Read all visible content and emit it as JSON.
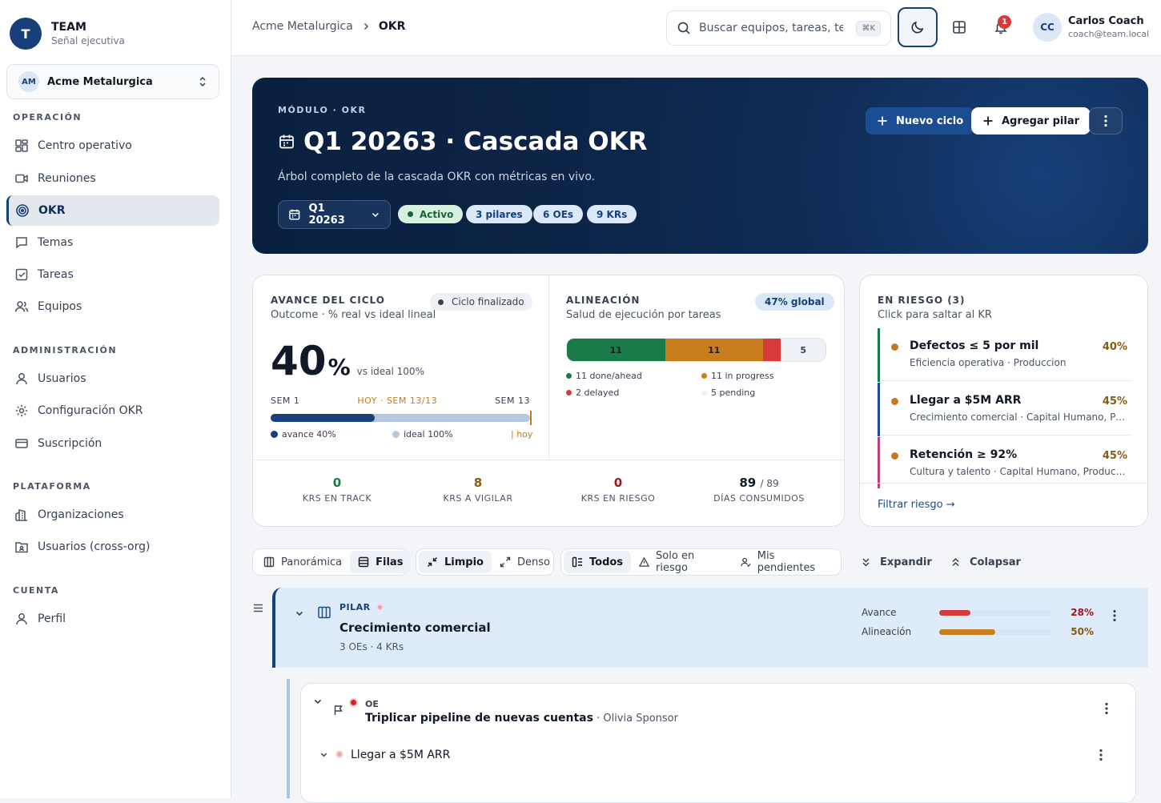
{
  "brand": {
    "initial": "T",
    "title": "TEAM",
    "subtitle": "Señal ejecutiva"
  },
  "org": {
    "initials": "AM",
    "name": "Acme Metalurgica"
  },
  "nav": {
    "operacion": "OPERACIÓN",
    "administracion": "ADMINISTRACIÓN",
    "plataforma": "PLATAFORMA",
    "cuenta": "CUENTA",
    "centro": "Centro operativo",
    "reuniones": "Reuniones",
    "okr": "OKR",
    "temas": "Temas",
    "tareas": "Tareas",
    "equipos": "Equipos",
    "usuarios": "Usuarios",
    "config_okr": "Configuración OKR",
    "suscripcion": "Suscripción",
    "organizaciones": "Organizaciones",
    "usuarios_cross": "Usuarios (cross-org)",
    "perfil": "Perfil"
  },
  "topbar": {
    "crumb_root": "Acme Metalurgica",
    "crumb_current": "OKR",
    "search_placeholder": "Buscar equipos, tareas, tem",
    "search_kbd": "⌘K",
    "notifications": "1",
    "user_initials": "CC",
    "user_name": "Carlos Coach",
    "user_email": "coach@team.local"
  },
  "hero": {
    "kicker": "MÓDULO · OKR",
    "title": "Q1 20263 · Cascada OKR",
    "description": "Árbol completo de la cascada OKR con métricas en vivo.",
    "cycle": "Q1 20263",
    "status": "Activo",
    "chip_pilares": "3 pilares",
    "chip_oes": "6 OEs",
    "chip_krs": "9 KRs",
    "btn_new": "Nuevo ciclo",
    "btn_add": "Agregar pilar"
  },
  "avance": {
    "title": "AVANCE DEL CICLO",
    "subtitle": "Outcome · % real vs ideal lineal",
    "badge": "Ciclo finalizado",
    "value": "40",
    "unit": "%",
    "ideal": "vs ideal 100%",
    "week_start": "SEM 1",
    "week_now": "HOY · SEM 13/13",
    "week_end": "SEM 13",
    "progress_fraction": 0.4,
    "legend_avance": "avance 40%",
    "legend_ideal": "ideal 100%",
    "legend_hoy": "| hoy"
  },
  "alineacion": {
    "title": "ALINEACIÓN",
    "subtitle": "Salud de ejecución por tareas",
    "badge": "47% global",
    "segments": [
      {
        "label": "11",
        "value": 11,
        "color": "#1a7a4a"
      },
      {
        "label": "11",
        "value": 11,
        "color": "#c97d1c"
      },
      {
        "label": "",
        "value": 2,
        "color": "#d63a3a"
      },
      {
        "label": "5",
        "value": 5,
        "color": "#eef1f5"
      }
    ],
    "legend_done": "11 done/ahead",
    "legend_progress": "11 in progress",
    "legend_delayed": "2 delayed",
    "legend_pending": "5 pending"
  },
  "stats": {
    "track_value": "0",
    "track_label": "KRS EN TRACK",
    "vigilar_value": "8",
    "vigilar_label": "KRS A VIGILAR",
    "riesgo_value": "0",
    "riesgo_label": "KRS EN RIESGO",
    "dias_value": "89",
    "dias_total": "/ 89",
    "dias_label": "DÍAS CONSUMIDOS"
  },
  "riesgo": {
    "title": "EN RIESGO (3)",
    "subtitle": "Click para saltar al KR",
    "items": [
      {
        "title": "Defectos ≤ 5 por mil",
        "sub": "Eficiencia operativa · Produccion",
        "pct": "40%",
        "color": "#1a7a4a"
      },
      {
        "title": "Llegar a $5M ARR",
        "sub": "Crecimiento comercial · Capital Humano, Produccion",
        "pct": "45%",
        "color": "#1c4d92"
      },
      {
        "title": "Retención ≥ 92%",
        "sub": "Cultura y talento · Capital Humano, Produccion",
        "pct": "45%",
        "color": "#b8457a"
      }
    ],
    "link": "Filtrar riesgo →"
  },
  "toolbar": {
    "panoramica": "Panorámica",
    "filas": "Filas",
    "limpio": "Limpio",
    "denso": "Denso",
    "todos": "Todos",
    "solo_riesgo": "Solo en riesgo",
    "pendientes": "Mis pendientes",
    "expandir": "Expandir",
    "colapsar": "Colapsar"
  },
  "pilar": {
    "kicker": "PILAR",
    "title": "Crecimiento comercial",
    "sub": "3 OEs · 4 KRs",
    "avance_label": "Avance",
    "avance_pct": "28%",
    "avance_value": 0.28,
    "alineacion_label": "Alineación",
    "alineacion_pct": "50%",
    "alineacion_value": 0.5
  },
  "oe": {
    "kicker": "OE",
    "title": "Triplicar pipeline de nuevas cuentas",
    "owner": " · Olivia Sponsor",
    "kr_title": "Llegar a $5M ARR"
  }
}
